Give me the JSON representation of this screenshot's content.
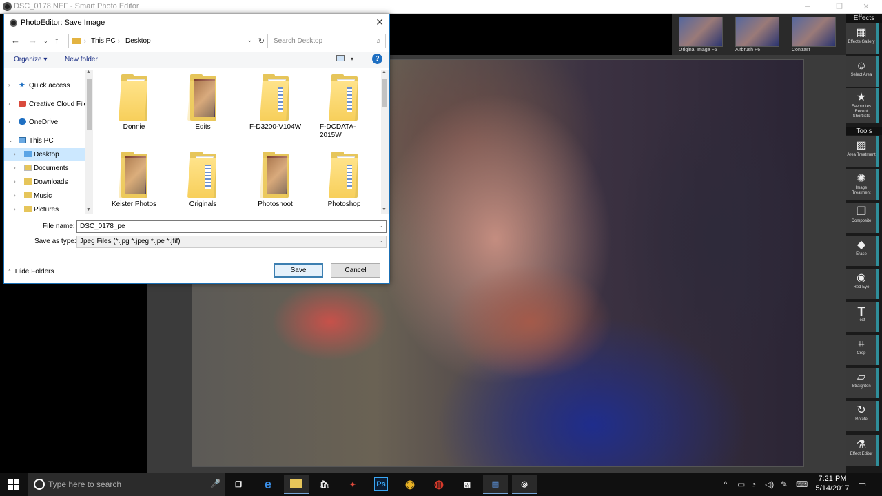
{
  "app": {
    "title": "DSC_0178.NEF - Smart Photo Editor",
    "window_controls": [
      "minimize",
      "maximize",
      "close"
    ]
  },
  "effects_strip": {
    "items": [
      {
        "label": "Original Image F5"
      },
      {
        "label": "Airbrush   F6"
      },
      {
        "label": "Contrast"
      }
    ]
  },
  "right_panel": {
    "effects_header": "Effects",
    "tools_header": "Tools",
    "effects_tools": [
      {
        "label": "Effects Gallery",
        "icon": "gallery-icon"
      },
      {
        "label": "Select Area",
        "icon": "select-area-icon"
      },
      {
        "label": "Favourites Recent Shortlists",
        "icon": "star-icon"
      }
    ],
    "tools": [
      {
        "label": "Area Treatment",
        "icon": "area-treatment-icon"
      },
      {
        "label": "Image Treatment",
        "icon": "image-treatment-icon"
      },
      {
        "label": "Composite",
        "icon": "composite-icon"
      },
      {
        "label": "Erase",
        "icon": "eraser-icon"
      },
      {
        "label": "Red Eye",
        "icon": "eye-icon"
      },
      {
        "label": "Text",
        "icon": "text-icon"
      },
      {
        "label": "Crop",
        "icon": "crop-icon"
      },
      {
        "label": "Straighten",
        "icon": "straighten-icon"
      },
      {
        "label": "Rotate",
        "icon": "rotate-icon"
      },
      {
        "label": "Effect Editor",
        "icon": "flask-icon"
      }
    ]
  },
  "dialog": {
    "title": "PhotoEditor: Save Image",
    "breadcrumb": [
      "This PC",
      "Desktop"
    ],
    "search_placeholder": "Search Desktop",
    "toolbar": {
      "organize": "Organize ▾",
      "new_folder": "New folder"
    },
    "nav_pane": [
      {
        "label": "Quick access",
        "level": 0,
        "icon": "star-icon",
        "expanded": false
      },
      {
        "label": "Creative Cloud Files",
        "level": 0,
        "icon": "creative-cloud-icon",
        "expanded": false
      },
      {
        "label": "OneDrive",
        "level": 0,
        "icon": "cloud-icon",
        "expanded": false
      },
      {
        "label": "This PC",
        "level": 0,
        "icon": "computer-icon",
        "expanded": true
      },
      {
        "label": "Desktop",
        "level": 1,
        "icon": "folder-icon",
        "expanded": false,
        "selected": true
      },
      {
        "label": "Documents",
        "level": 1,
        "icon": "documents-icon",
        "expanded": false
      },
      {
        "label": "Downloads",
        "level": 1,
        "icon": "downloads-icon",
        "expanded": false
      },
      {
        "label": "Music",
        "level": 1,
        "icon": "music-icon",
        "expanded": false
      },
      {
        "label": "Pictures",
        "level": 1,
        "icon": "pictures-icon",
        "expanded": false
      }
    ],
    "files": [
      {
        "name": "Donnie",
        "kind": "docs"
      },
      {
        "name": "Edits",
        "kind": "photo"
      },
      {
        "name": "F-D3200-V104W",
        "kind": "docs"
      },
      {
        "name": "F-DCDATA-2015W",
        "kind": "docs"
      },
      {
        "name": "Keister Photos",
        "kind": "photo"
      },
      {
        "name": "Originals",
        "kind": "docs"
      },
      {
        "name": "Photoshoot",
        "kind": "photo"
      },
      {
        "name": "Photoshop",
        "kind": "docs"
      }
    ],
    "file_name_label": "File name:",
    "file_name_value": "DSC_0178_pe",
    "save_type_label": "Save as type:",
    "save_type_value": "Jpeg Files (*.jpg *.jpeg *.jpe *.jfif)",
    "hide_folders": "Hide Folders",
    "save_button": "Save",
    "cancel_button": "Cancel"
  },
  "taskbar": {
    "search_placeholder": "Type here to search",
    "time": "7:21 PM",
    "date": "5/14/2017",
    "apps": [
      {
        "name": "task-view-icon",
        "glyph": "❐"
      },
      {
        "name": "edge-icon",
        "glyph": "e"
      },
      {
        "name": "file-explorer-icon",
        "glyph": "▭"
      },
      {
        "name": "store-icon",
        "glyph": "🛍"
      },
      {
        "name": "app-red-icon",
        "glyph": "✦"
      },
      {
        "name": "photoshop-icon",
        "glyph": "Ps"
      },
      {
        "name": "chrome-icon",
        "glyph": "◉"
      },
      {
        "name": "app-record-icon",
        "glyph": "◍"
      },
      {
        "name": "photos-icon",
        "glyph": "▨"
      },
      {
        "name": "app-blue-icon",
        "glyph": "▤"
      },
      {
        "name": "smart-photo-editor-icon",
        "glyph": "◎"
      }
    ],
    "tray": [
      "chevron-up-icon",
      "battery-icon",
      "network-icon",
      "volume-icon",
      "pen-icon",
      "keyboard-icon"
    ]
  },
  "colors": {
    "accent": "#2f8e9a",
    "dialog_border": "#1a6fb4",
    "selection": "#cce8ff"
  }
}
